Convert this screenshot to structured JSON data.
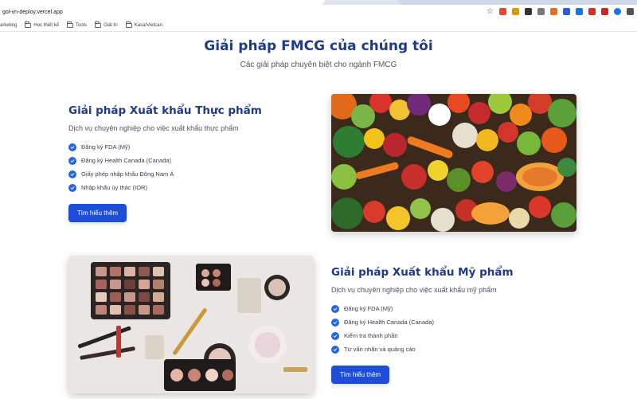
{
  "browser": {
    "url": "gol-vn-deploy.vercel.app",
    "bookmarks": [
      "arketing",
      "Học thiết kế",
      "Tools",
      "Giải trí",
      "Kasa/Vietcan"
    ],
    "extension_colors": [
      "#e8452c",
      "#d89b00",
      "#333333",
      "#777777",
      "#e2711d",
      "#2b5fd9",
      "#1a73e8",
      "#d93025",
      "#c62828",
      "#1a73e8",
      "#555555"
    ]
  },
  "header": {
    "title": "Giải pháp FMCG của chúng tôi",
    "subtitle": "Các giải pháp chuyên biệt cho ngành FMCG"
  },
  "food": {
    "title": "Giải pháp Xuất khẩu Thực phẩm",
    "description": "Dịch vụ chuyên nghiệp cho việc xuất khẩu thực phẩm",
    "features": [
      "Đăng ký FDA (Mỹ)",
      "Đăng ký Health Canada (Canada)",
      "Giấy phép nhập khẩu Đông Nam Á",
      "Nhập khẩu ủy thác (IOR)"
    ],
    "button": "Tìm hiểu thêm"
  },
  "cosmetics": {
    "title": "Giải pháp Xuất khẩu Mỹ phẩm",
    "description": "Dịch vụ chuyên nghiệp cho việc xuất khẩu mỹ phẩm",
    "features": [
      "Đăng ký FDA (Mỹ)",
      "Đăng ký Health Canada (Canada)",
      "Kiểm tra thành phần",
      "Tư vấn nhãn và quảng cáo"
    ],
    "button": "Tìm hiểu thêm"
  },
  "colors": {
    "brand": "#1f3a8a",
    "accent": "#1d4ed8",
    "check": "#2563eb"
  }
}
